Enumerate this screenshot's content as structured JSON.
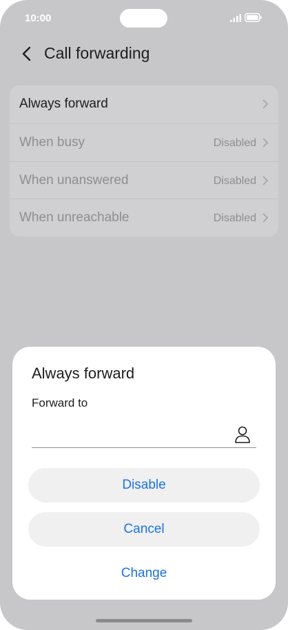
{
  "status": {
    "time": "10:00"
  },
  "header": {
    "title": "Call forwarding"
  },
  "options": [
    {
      "label": "Always forward",
      "value": ""
    },
    {
      "label": "When busy",
      "value": "Disabled"
    },
    {
      "label": "When unanswered",
      "value": "Disabled"
    },
    {
      "label": "When unreachable",
      "value": "Disabled"
    }
  ],
  "dialog": {
    "title": "Always forward",
    "field_label": "Forward to",
    "field_value": "",
    "buttons": {
      "disable": "Disable",
      "cancel": "Cancel",
      "change": "Change"
    }
  },
  "colors": {
    "accent": "#1a73e8",
    "background": "#c7c7c9",
    "sheet": "#ffffff"
  }
}
